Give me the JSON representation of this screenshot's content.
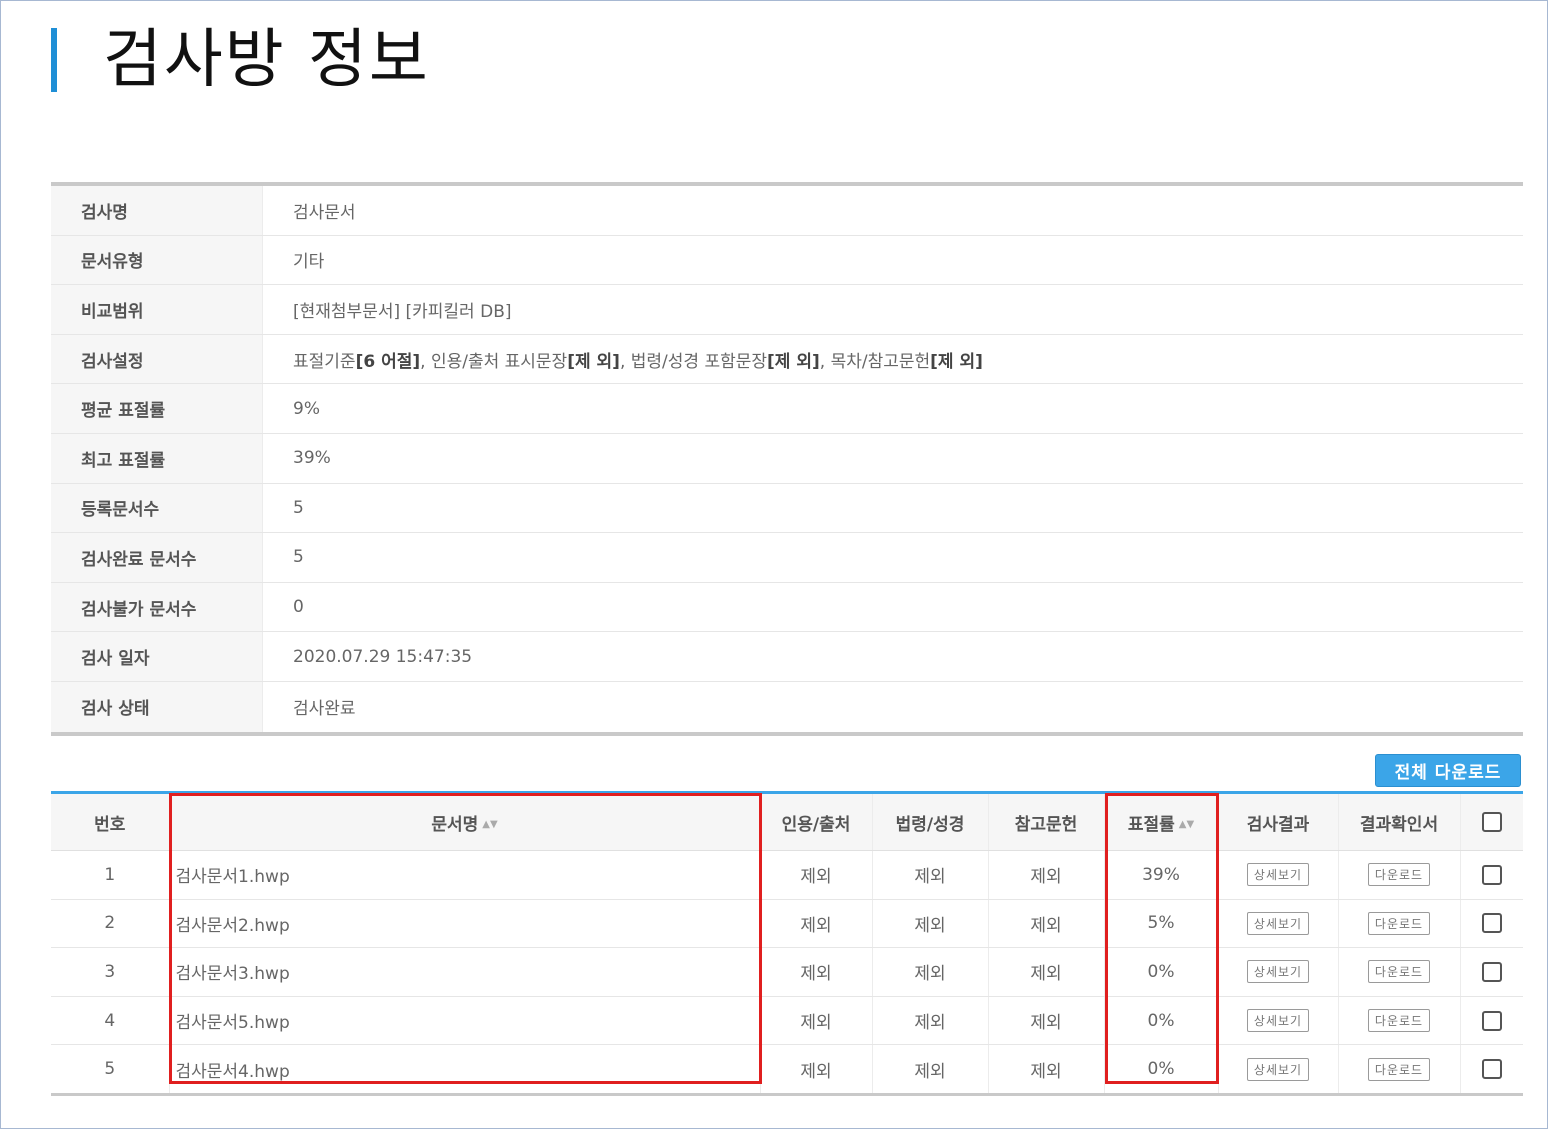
{
  "page": {
    "title": "검사방 정보"
  },
  "info": {
    "rows": [
      {
        "label": "검사명",
        "value": "검사문서"
      },
      {
        "label": "문서유형",
        "value": "기타"
      },
      {
        "label": "비교범위",
        "value": "[현재첨부문서] [카피킬러 DB]"
      },
      {
        "label": "검사설정",
        "value": ""
      },
      {
        "label": "평균 표절률",
        "value": "9%"
      },
      {
        "label": "최고 표절률",
        "value": "39%"
      },
      {
        "label": "등록문서수",
        "value": "5"
      },
      {
        "label": "검사완료 문서수",
        "value": "5"
      },
      {
        "label": "검사불가 문서수",
        "value": "0"
      },
      {
        "label": "검사 일자",
        "value": "2020.07.29 15:47:35"
      },
      {
        "label": "검사 상태",
        "value": "검사완료"
      }
    ],
    "settings": {
      "p1": "표절기준 ",
      "b1": "[6 어절]",
      "p2": ", 인용/출처 표시문장 ",
      "b2": "[제 외]",
      "p3": ", 법령/성경 포함문장 ",
      "b3": "[제 외]",
      "p4": ", 목차/참고문헌 ",
      "b4": "[제 외]"
    }
  },
  "download_all_label": "전체 다운로드",
  "results": {
    "headers": {
      "no": "번호",
      "docname": "문서명",
      "citation": "인용/출처",
      "law": "법령/성경",
      "reference": "참고문헌",
      "rate": "표절률",
      "result": "검사결과",
      "certificate": "결과확인서"
    },
    "sort_icon": "▲▼",
    "view_label": "상세보기",
    "download_label": "다운로드",
    "rows": [
      {
        "no": "1",
        "docname": "검사문서1.hwp",
        "citation": "제외",
        "law": "제외",
        "reference": "제외",
        "rate": "39%"
      },
      {
        "no": "2",
        "docname": "검사문서2.hwp",
        "citation": "제외",
        "law": "제외",
        "reference": "제외",
        "rate": "5%"
      },
      {
        "no": "3",
        "docname": "검사문서3.hwp",
        "citation": "제외",
        "law": "제외",
        "reference": "제외",
        "rate": "0%"
      },
      {
        "no": "4",
        "docname": "검사문서5.hwp",
        "citation": "제외",
        "law": "제외",
        "reference": "제외",
        "rate": "0%"
      },
      {
        "no": "5",
        "docname": "검사문서4.hwp",
        "citation": "제외",
        "law": "제외",
        "reference": "제외",
        "rate": "0%"
      }
    ]
  },
  "colors": {
    "accent": "#3ba5e8",
    "highlight": "#e01f1f"
  }
}
